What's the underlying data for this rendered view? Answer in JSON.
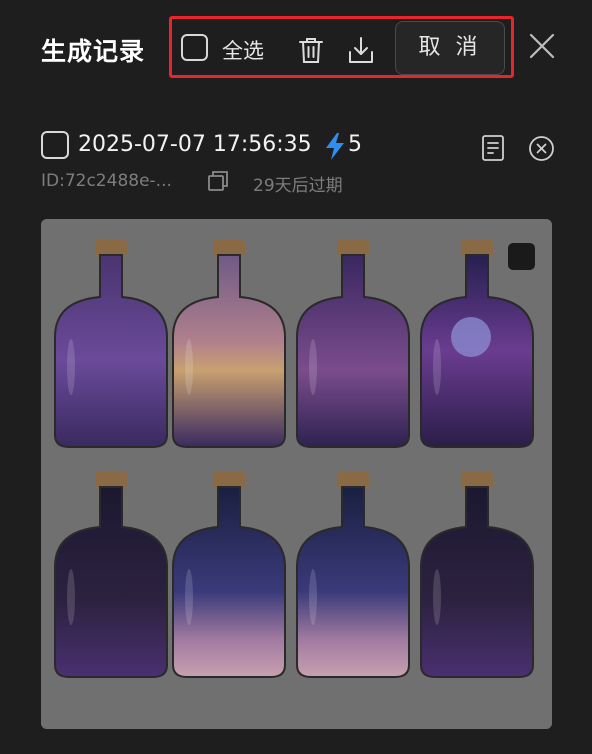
{
  "header": {
    "title": "生成记录",
    "select_all_label": "全选",
    "cancel_label": "取 消"
  },
  "record": {
    "datetime": "2025-07-07 17:56:35",
    "credits": "5",
    "id_text": "ID:72c2488e-...",
    "expiry_text": "29天后过期"
  },
  "icons": {
    "select_all": "checkbox-icon",
    "delete": "trash-icon",
    "download": "download-icon",
    "close": "close-icon",
    "credits": "lightning-bolt-icon",
    "details": "document-icon",
    "remove": "circle-close-icon",
    "copy": "copy-icon"
  },
  "colors": {
    "highlight_border": "#e8242c",
    "bolt": "#2f8ef0",
    "background": "#1e1e1e"
  }
}
